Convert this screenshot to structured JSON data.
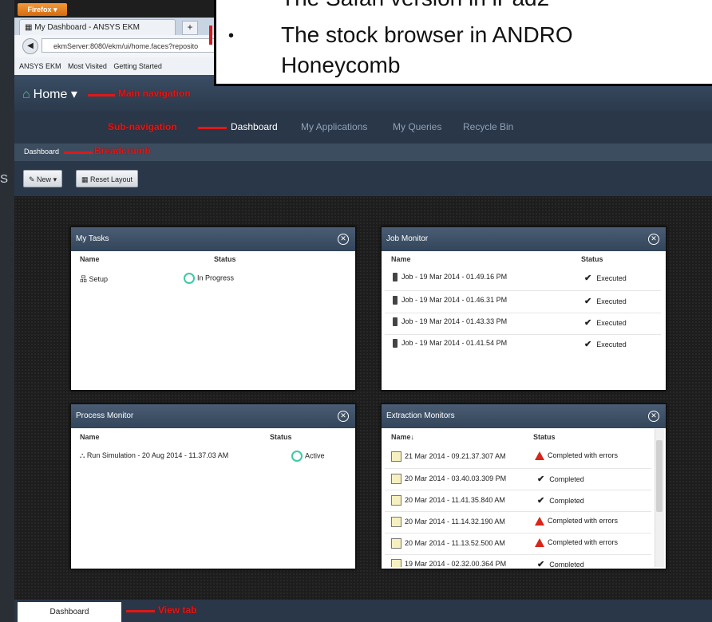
{
  "browser": {
    "firefox_button": "Firefox",
    "tab_title": "My Dashboard - ANSYS EKM",
    "new_tab": "+",
    "url": "ekmServer:8080/ekm/ui/home.faces?reposito",
    "bookmarks": [
      "ANSYS EKM",
      "Most Visited",
      "Getting Started"
    ]
  },
  "left_strip_text": "S",
  "app": {
    "home_label": "Home",
    "subnav": [
      "Dashboard",
      "My Applications",
      "My Queries",
      "Recycle Bin"
    ],
    "breadcrumb": "Dashboard",
    "toolbar": {
      "new_label": "New",
      "reset_label": "Reset Layout"
    },
    "view_tab": "Dashboard"
  },
  "annotations": {
    "main_navigation": "Main navigation",
    "sub_navigation": "Sub-navigation",
    "breadcrumb": "Breadcrumb",
    "view_tab": "View tab"
  },
  "panels": {
    "my_tasks": {
      "title": "My Tasks",
      "columns": [
        "Name",
        "Status"
      ],
      "rows": [
        {
          "name": "Setup",
          "status": "In Progress"
        }
      ]
    },
    "job_monitor": {
      "title": "Job Monitor",
      "columns": [
        "Name",
        "Status"
      ],
      "rows": [
        {
          "name": "Job - 19 Mar 2014 - 01.49.16 PM",
          "status": "Executed"
        },
        {
          "name": "Job - 19 Mar 2014 - 01.46.31 PM",
          "status": "Executed"
        },
        {
          "name": "Job - 19 Mar 2014 - 01.43.33 PM",
          "status": "Executed"
        },
        {
          "name": "Job - 19 Mar 2014 - 01.41.54 PM",
          "status": "Executed"
        }
      ]
    },
    "process_monitor": {
      "title": "Process Monitor",
      "columns": [
        "Name",
        "Status"
      ],
      "rows": [
        {
          "name": "Run Simulation - 20 Aug 2014 - 11.37.03 AM",
          "status": "Active"
        }
      ]
    },
    "extraction_monitors": {
      "title": "Extraction Monitors",
      "columns": [
        "Name↓",
        "Status"
      ],
      "rows": [
        {
          "name": "21 Mar 2014 - 09.21.37.307 AM",
          "status": "Completed with errors"
        },
        {
          "name": "20 Mar 2014 - 03.40.03.309 PM",
          "status": "Completed"
        },
        {
          "name": "20 Mar 2014 - 11.41.35.840 AM",
          "status": "Completed"
        },
        {
          "name": "20 Mar 2014 - 11.14.32.190 AM",
          "status": "Completed with errors"
        },
        {
          "name": "20 Mar 2014 - 11.13.52.500 AM",
          "status": "Completed with errors"
        },
        {
          "name": "19 Mar 2014 - 02.32.00.364 PM",
          "status": "Completed"
        }
      ]
    }
  },
  "overlay": {
    "line1": "The Safari version in iPad2",
    "bullet": "•",
    "line2": "The stock browser in ANDRO",
    "line3": "Honeycomb"
  }
}
